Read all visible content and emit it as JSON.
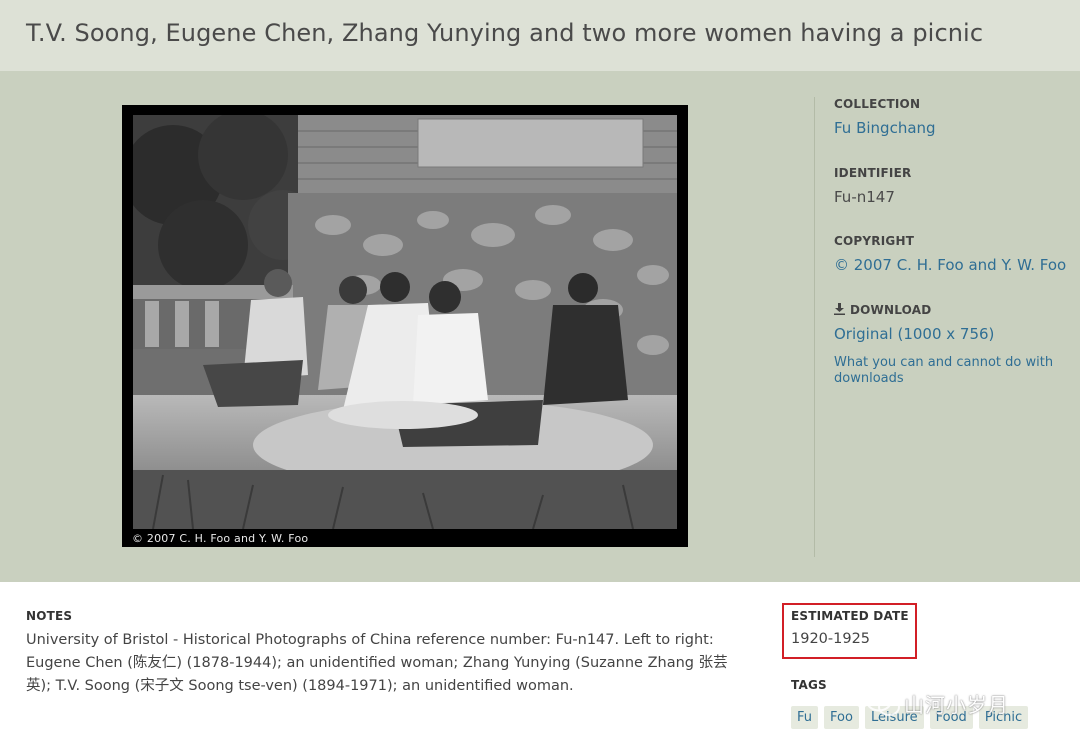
{
  "page": {
    "title": "T.V. Soong, Eugene Chen, Zhang Yunying and two more women having a picnic"
  },
  "photo": {
    "caption": "© 2007 C. H. Foo and Y. W. Foo"
  },
  "sidebar": {
    "collection_label": "COLLECTION",
    "collection_value": "Fu Bingchang",
    "identifier_label": "IDENTIFIER",
    "identifier_value": "Fu-n147",
    "copyright_label": "COPYRIGHT",
    "copyright_value": "© 2007 C. H. Foo and Y. W. Foo",
    "download_label": "DOWNLOAD",
    "download_icon": "download-icon",
    "download_original": "Original (1000 x 756)",
    "download_rights": "What you can and cannot do with downloads"
  },
  "notes": {
    "label": "NOTES",
    "text": "University of Bristol - Historical Photographs of China reference number: Fu-n147. Left to right: Eugene Chen (陈友仁) (1878-1944); an unidentified woman; Zhang Yunying (Suzanne Zhang 张芸英); T.V. Soong (宋子文 Soong tse-ven) (1894-1971); an unidentified woman."
  },
  "date": {
    "label": "ESTIMATED DATE",
    "value": "1920-1925",
    "highlight_color": "#d21f26"
  },
  "tags": {
    "label": "TAGS",
    "items": [
      "Fu",
      "Foo",
      "Leisure",
      "Food",
      "Picnic"
    ]
  },
  "watermark": {
    "text": "山河小岁月",
    "icon": "wechat-icon"
  },
  "colors": {
    "link": "#2f6e94",
    "title_bar": "#dde1d6",
    "main_bg": "#c9d0bf"
  }
}
